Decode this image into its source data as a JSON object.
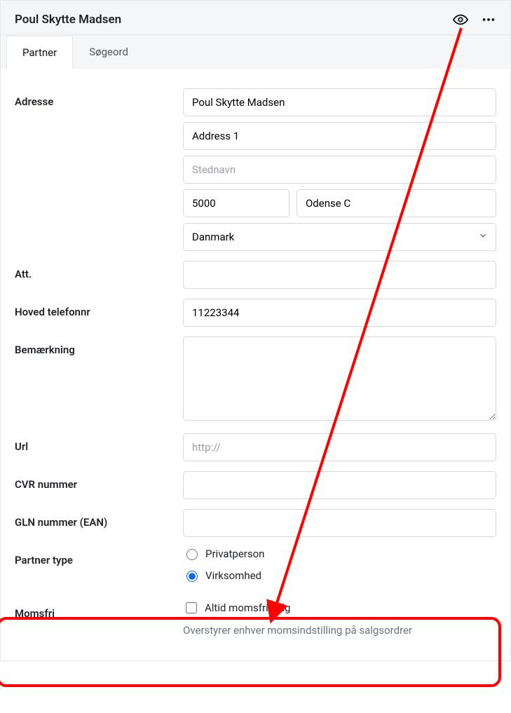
{
  "header": {
    "title": "Poul Skytte Madsen"
  },
  "tabs": {
    "partner": "Partner",
    "sogeord": "Søgeord"
  },
  "labels": {
    "adresse": "Adresse",
    "att": "Att.",
    "telefon": "Hoved telefonnr",
    "bemaerkning": "Bemærkning",
    "url": "Url",
    "cvr": "CVR nummer",
    "gln": "GLN nummer (EAN)",
    "partner_type": "Partner type",
    "momsfri": "Momsfri"
  },
  "fields": {
    "name": "Poul Skytte Madsen",
    "address1": "Address 1",
    "stednavn_placeholder": "Stednavn",
    "postal": "5000",
    "city": "Odense C",
    "country": "Danmark",
    "telefon": "11223344",
    "url_placeholder": "http://"
  },
  "partner_type": {
    "privat": "Privatperson",
    "virksomhed": "Virksomhed"
  },
  "momsfri": {
    "checkbox_label": "Altid momsfri salg",
    "hint": "Overstyrer enhver momsindstilling på salgsordrer"
  }
}
